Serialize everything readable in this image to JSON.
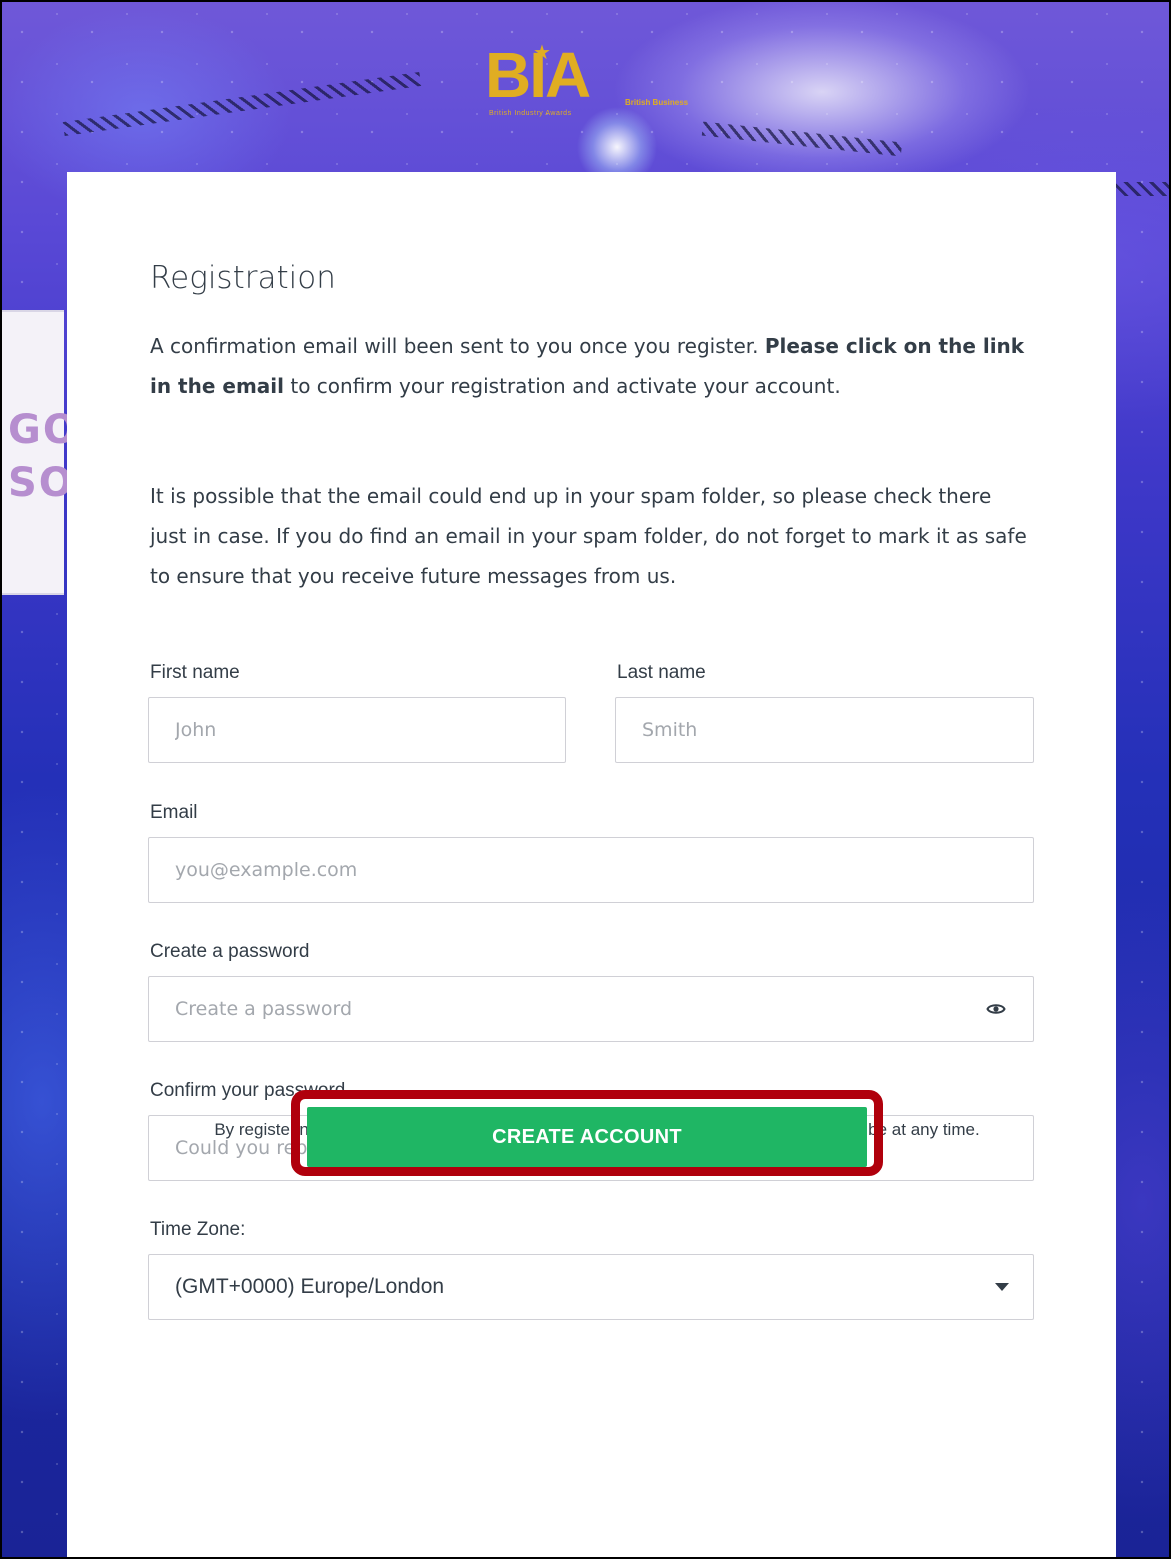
{
  "brand": {
    "logo_text": "BIA",
    "logo_subtitle": "British Industry Awards",
    "logo_side_text": "British Business"
  },
  "background": {
    "banner_text_top": "GOR",
    "banner_text_bottom": "SOR"
  },
  "form": {
    "title": "Registration",
    "intro_part1": "A confirmation email will been sent to you once you register. ",
    "intro_bold": "Please click on the link in the email",
    "intro_part2": " to confirm your registration and activate your account.",
    "spam_note": "It is possible that the email could end up in your spam folder, so please check there just in case. If you do find an email in your spam folder, do not forget to mark it as safe to ensure that you receive future messages from us.",
    "first_name": {
      "label": "First name",
      "placeholder": "John",
      "value": ""
    },
    "last_name": {
      "label": "Last name",
      "placeholder": "Smith",
      "value": ""
    },
    "email": {
      "label": "Email",
      "placeholder": "you@example.com",
      "value": ""
    },
    "password": {
      "label": "Create a password",
      "placeholder": "Create a password",
      "value": ""
    },
    "confirm_password": {
      "label": "Confirm your password",
      "placeholder": "Could you repeat that?",
      "value": ""
    },
    "timezone": {
      "label": "Time Zone:",
      "selected": "(GMT+0000) Europe/London"
    },
    "legal": "By registering, you agree to receive email communications from us. You may unsubscribe at any time.",
    "submit_label": "CREATE ACCOUNT"
  },
  "icons": {
    "password_toggle": "eye-icon",
    "select_caret": "chevron-down-icon"
  },
  "colors": {
    "primary_button": "#1fb664",
    "highlight_box": "#b0000c",
    "logo_gold": "#e0ad22",
    "text": "#333d47"
  }
}
